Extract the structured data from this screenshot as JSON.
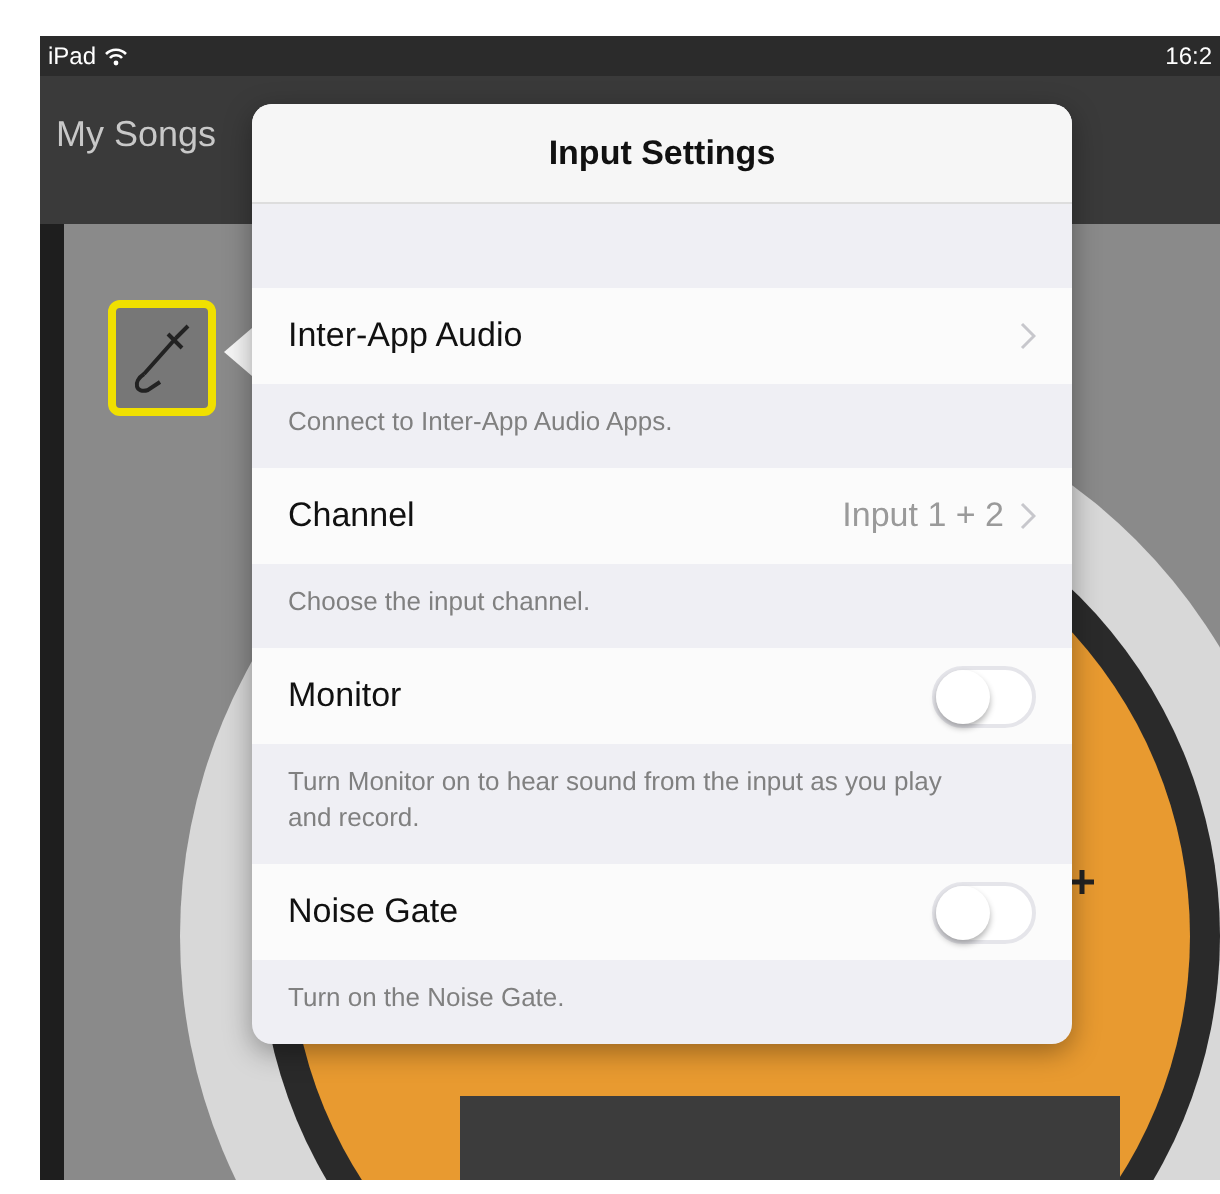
{
  "status_bar": {
    "device": "iPad",
    "time": "16:2"
  },
  "nav_bar": {
    "back_title": "My Songs"
  },
  "popover": {
    "title": "Input Settings",
    "rows": [
      {
        "kind": "link",
        "label": "Inter-App Audio",
        "footer": "Connect to Inter-App Audio Apps."
      },
      {
        "kind": "link",
        "label": "Channel",
        "value": "Input 1 + 2",
        "footer": "Choose the input channel."
      },
      {
        "kind": "toggle",
        "label": "Monitor",
        "on": false,
        "footer": "Turn Monitor on to hear sound from the input as you play and record."
      },
      {
        "kind": "toggle",
        "label": "Noise Gate",
        "on": false,
        "footer": "Turn on the Noise Gate."
      }
    ]
  }
}
